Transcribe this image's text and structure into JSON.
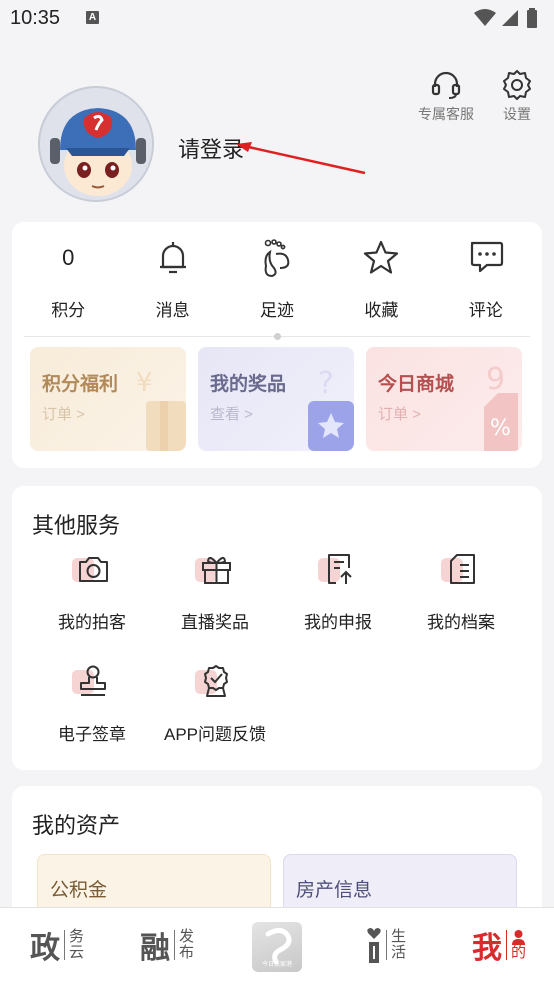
{
  "status_bar": {
    "time": "10:35",
    "notification_icon": "A"
  },
  "header": {
    "service": {
      "label": "专属客服",
      "icon": "headset-icon"
    },
    "settings": {
      "label": "设置",
      "icon": "gear-icon"
    },
    "login_text": "请登录"
  },
  "stats": [
    {
      "value": "0",
      "label": "积分"
    },
    {
      "icon": "bell-icon",
      "label": "消息"
    },
    {
      "icon": "footprint-icon",
      "label": "足迹"
    },
    {
      "icon": "star-icon",
      "label": "收藏"
    },
    {
      "icon": "comment-icon",
      "label": "评论"
    }
  ],
  "promos": [
    {
      "title": "积分福利",
      "sub": "订单 >"
    },
    {
      "title": "我的奖品",
      "sub": "查看 >"
    },
    {
      "title": "今日商城",
      "sub": "订单 >"
    }
  ],
  "other_services": {
    "title": "其他服务",
    "items": [
      {
        "label": "我的拍客",
        "icon": "camera-icon"
      },
      {
        "label": "直播奖品",
        "icon": "gift-icon"
      },
      {
        "label": "我的申报",
        "icon": "report-icon"
      },
      {
        "label": "我的档案",
        "icon": "archive-icon"
      },
      {
        "label": "电子签章",
        "icon": "stamp-icon"
      },
      {
        "label": "APP问题反馈",
        "icon": "feedback-icon"
      }
    ]
  },
  "assets": {
    "title": "我的资产",
    "items": [
      {
        "label": "公积金"
      },
      {
        "label": "房产信息"
      }
    ]
  },
  "bottom_nav": [
    {
      "big": "政",
      "small1": "务",
      "small2": "云"
    },
    {
      "big": "融",
      "small1": "发",
      "small2": "布"
    },
    {
      "logo": "今日张家港"
    },
    {
      "big": "i",
      "small1": "生",
      "small2": "活"
    },
    {
      "big": "我",
      "small1": "",
      "small2": "的",
      "active": true
    }
  ],
  "colors": {
    "accent": "#d82b2b",
    "background": "#f4f4f6"
  }
}
